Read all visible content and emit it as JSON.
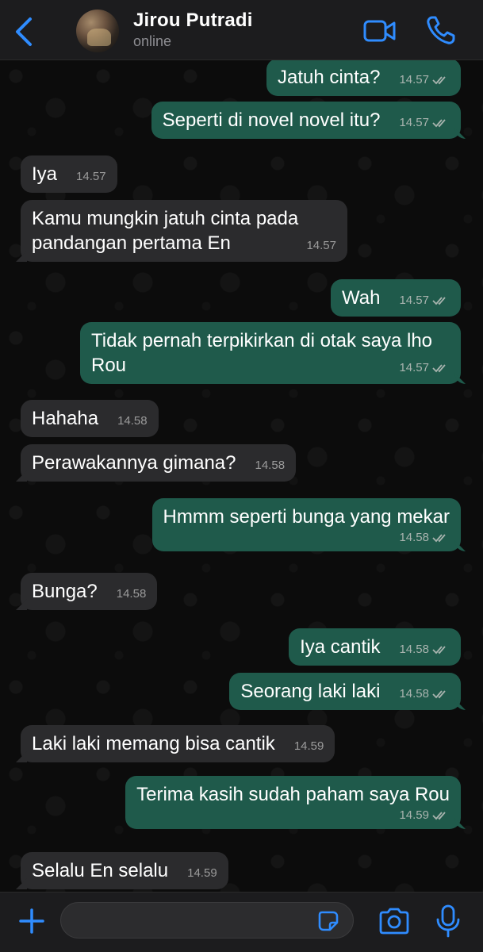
{
  "header": {
    "contact_name": "Jirou Putradi",
    "status": "online",
    "icons": {
      "back": "chevron-left-icon",
      "video": "video-camera-icon",
      "call": "phone-icon"
    }
  },
  "colors": {
    "accent": "#2f8cff",
    "outgoing_bubble": "#1f5a4b",
    "incoming_bubble": "#2b2b2d",
    "tick": "#a8b3ae"
  },
  "messages": [
    {
      "direction": "out",
      "text": "Jatuh cinta?",
      "time": "14.57",
      "read": true
    },
    {
      "direction": "out",
      "text": "Seperti di novel novel itu?",
      "time": "14.57",
      "read": true
    },
    {
      "direction": "in",
      "text": "Iya",
      "time": "14.57"
    },
    {
      "direction": "in",
      "text": "Kamu mungkin jatuh cinta pada pandangan pertama En",
      "time": "14.57"
    },
    {
      "direction": "out",
      "text": "Wah",
      "time": "14.57",
      "read": true
    },
    {
      "direction": "out",
      "text": "Tidak pernah terpikirkan di otak saya lho Rou",
      "time": "14.57",
      "read": true
    },
    {
      "direction": "in",
      "text": "Hahaha",
      "time": "14.58"
    },
    {
      "direction": "in",
      "text": "Perawakannya gimana?",
      "time": "14.58"
    },
    {
      "direction": "out",
      "text": "Hmmm seperti bunga yang mekar",
      "time": "14.58",
      "read": true
    },
    {
      "direction": "in",
      "text": "Bunga?",
      "time": "14.58"
    },
    {
      "direction": "out",
      "text": "Iya cantik",
      "time": "14.58",
      "read": true
    },
    {
      "direction": "out",
      "text": "Seorang laki laki",
      "time": "14.58",
      "read": true
    },
    {
      "direction": "in",
      "text": "Laki laki memang bisa cantik",
      "time": "14.59"
    },
    {
      "direction": "out",
      "text": "Terima kasih sudah paham saya Rou",
      "time": "14.59",
      "read": true
    },
    {
      "direction": "in",
      "text": "Selalu En selalu",
      "time": "14.59"
    }
  ],
  "composer": {
    "value": "",
    "icons": {
      "plus": "plus-icon",
      "sticker": "sticker-icon",
      "camera": "camera-icon",
      "mic": "microphone-icon"
    }
  }
}
